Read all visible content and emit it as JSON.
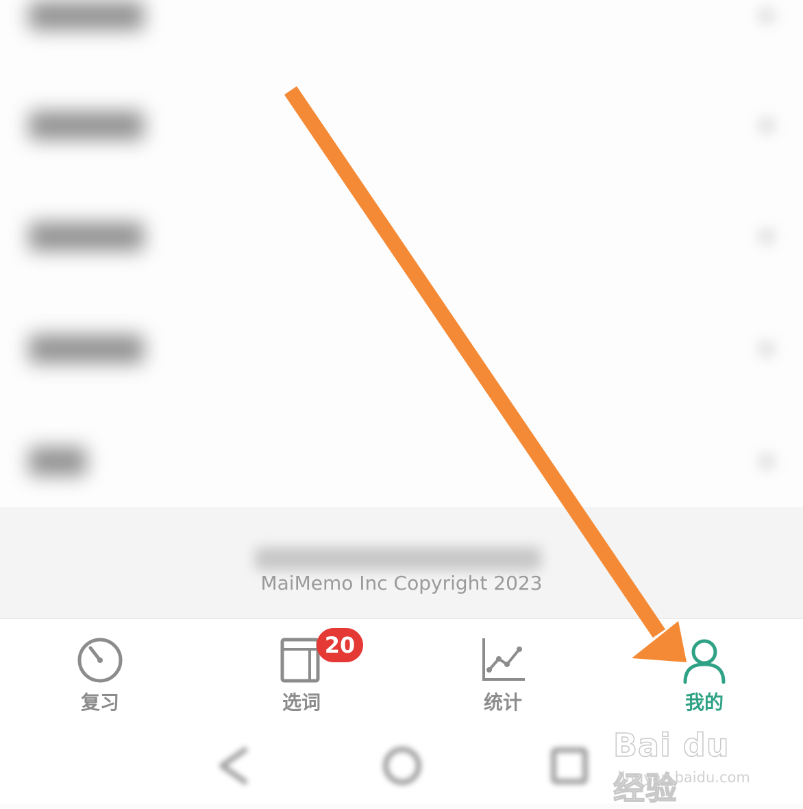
{
  "settings_list": {
    "rows": [
      {
        "label": "",
        "state": "blurred"
      },
      {
        "label": "",
        "state": "blurred"
      },
      {
        "label": "",
        "state": "blurred"
      },
      {
        "label": "",
        "state": "blurred"
      },
      {
        "label": "",
        "state": "blurred"
      }
    ],
    "row_icon": "chevron-right-icon"
  },
  "footer": {
    "copyright": "MaiMemo Inc Copyright 2023"
  },
  "tabbar": {
    "tabs": [
      {
        "label": "复习",
        "icon": "gauge-icon",
        "active": false
      },
      {
        "label": "选词",
        "icon": "book-icon",
        "active": false,
        "badge": "20"
      },
      {
        "label": "统计",
        "icon": "line-chart-icon",
        "active": false
      },
      {
        "label": "我的",
        "icon": "person-icon",
        "active": true
      }
    ],
    "active_color": "#2fa285",
    "inactive_color": "#8c8c8c",
    "badge_color": "#e53935"
  },
  "system_nav": {
    "buttons": [
      "back-icon",
      "home-icon",
      "recents-icon"
    ]
  },
  "watermark": {
    "brand": "Bai du 经验",
    "url": "jingyan.baidu.com"
  },
  "annotation": {
    "type": "arrow",
    "color": "#f48a35",
    "points_to": "我的"
  }
}
